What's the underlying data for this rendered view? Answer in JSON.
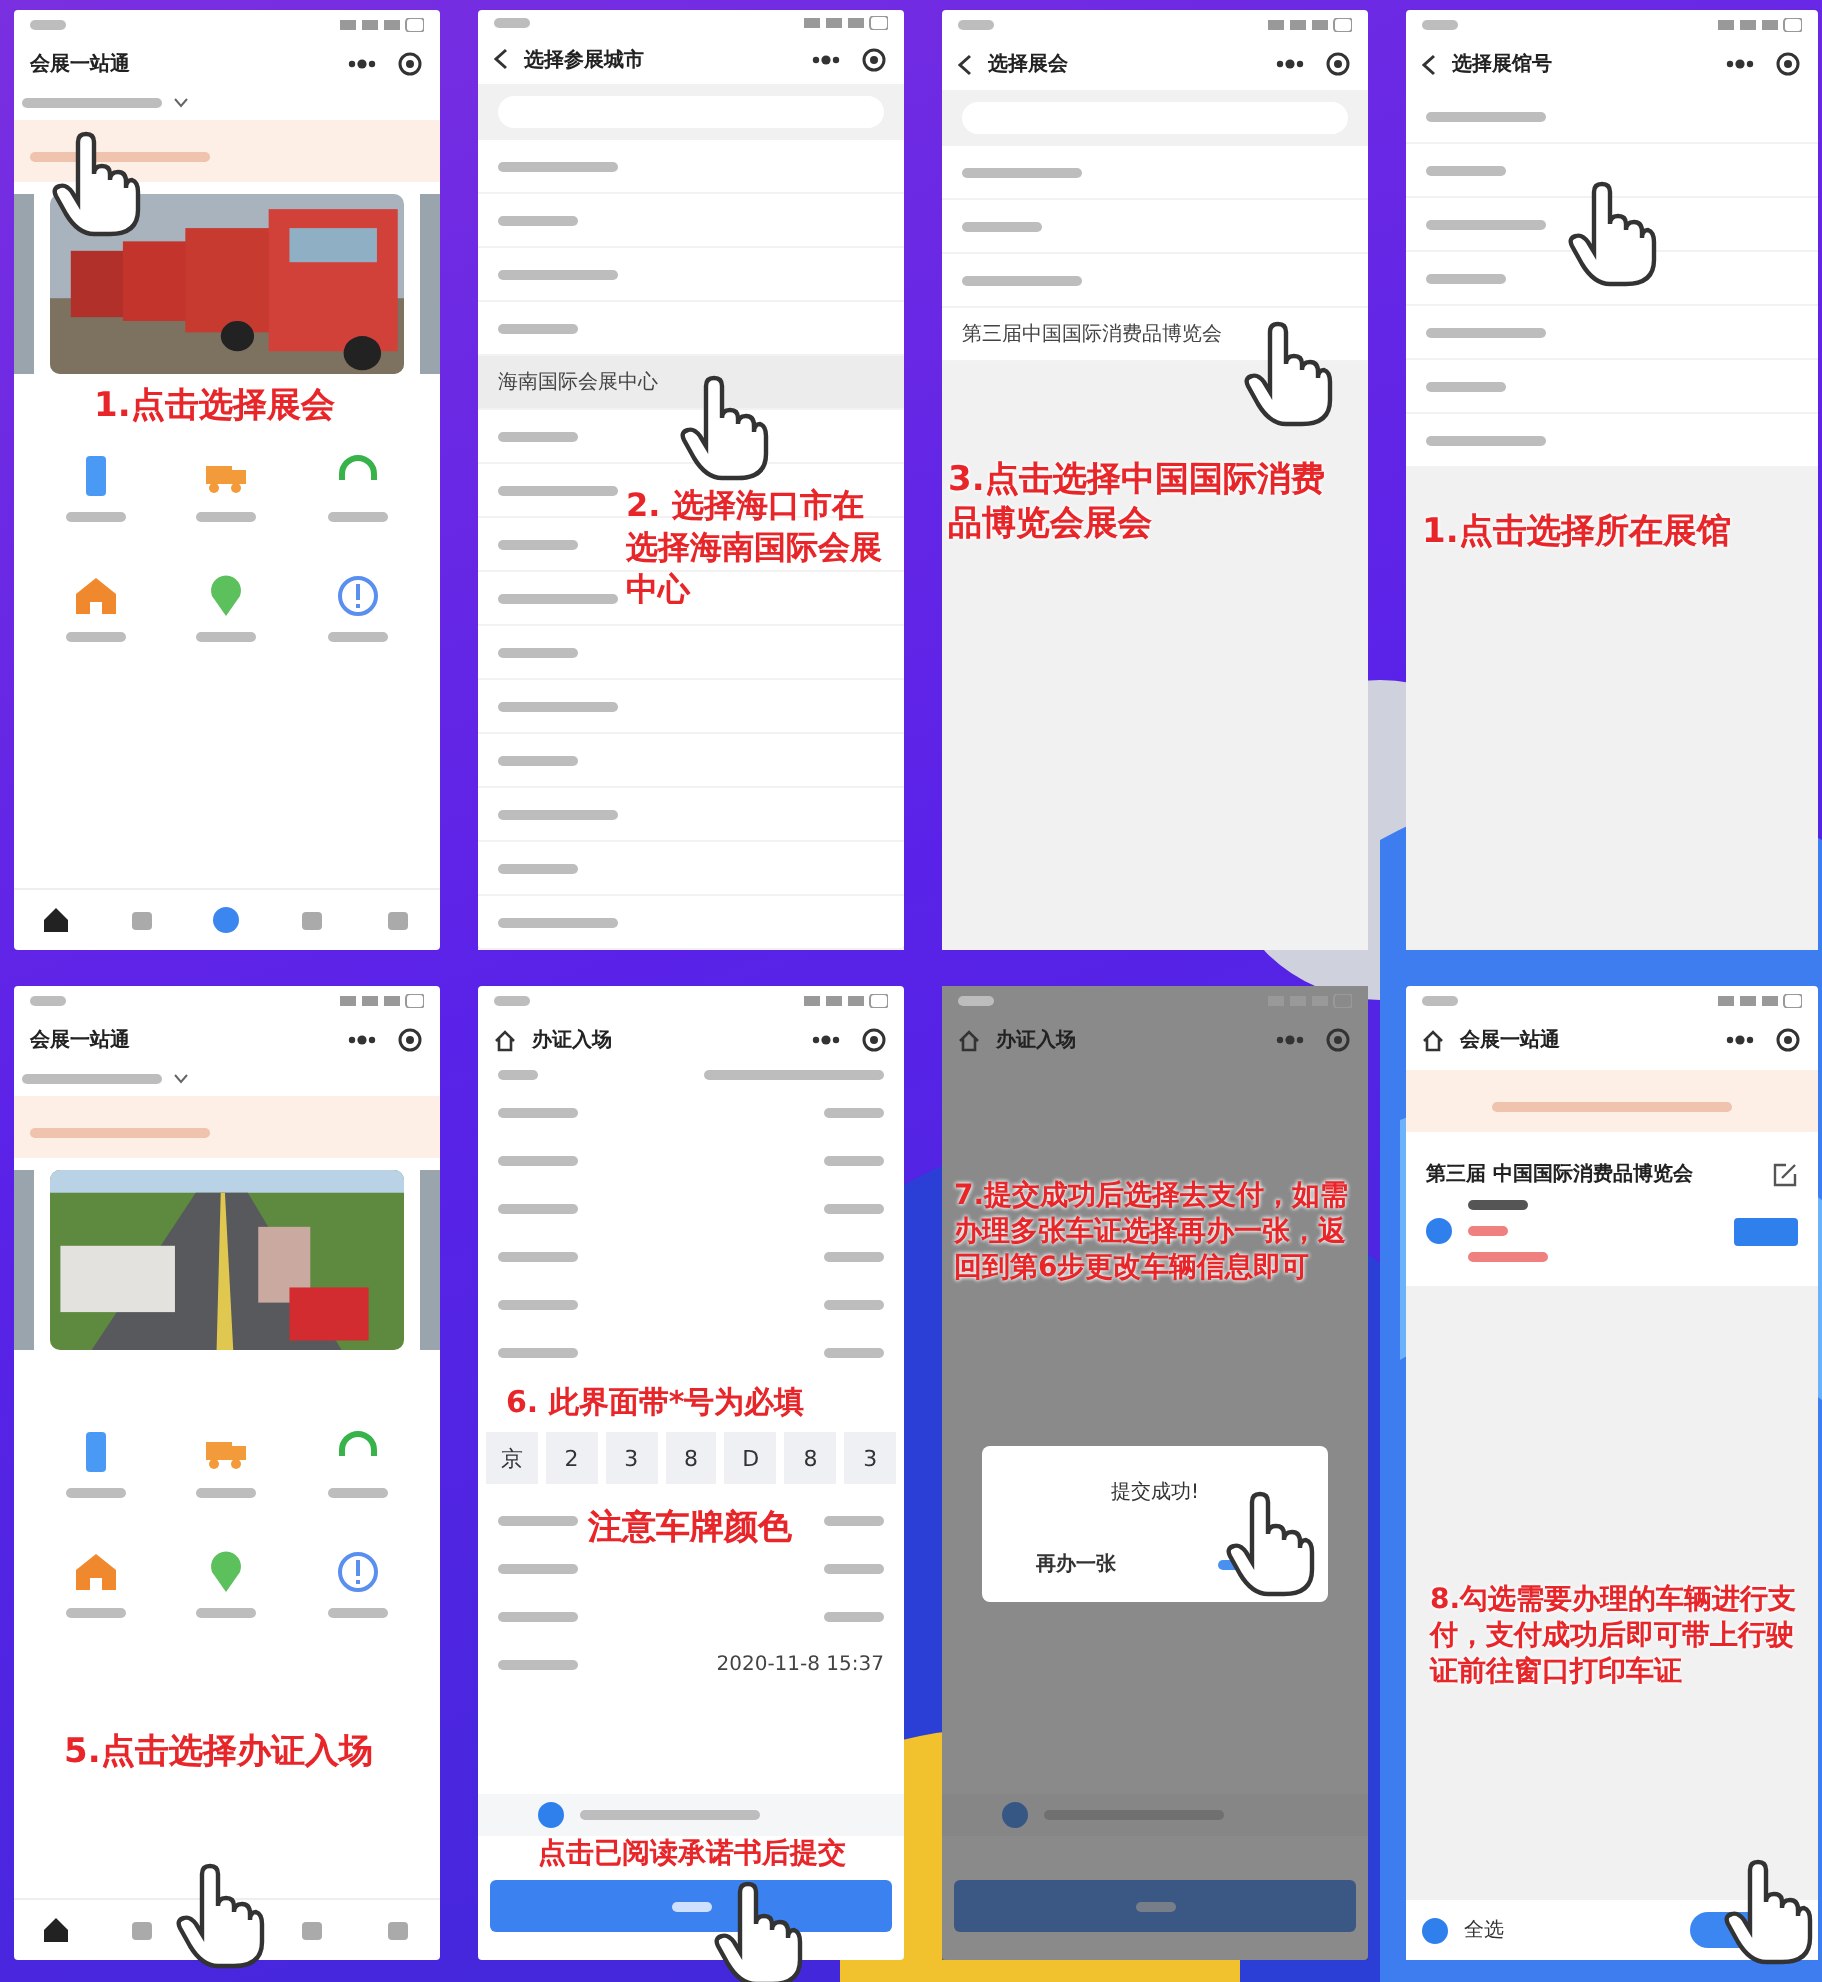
{
  "screens": [
    {
      "kind": "home",
      "title": "会展一站通",
      "annotations": [
        "1.点击选择展会"
      ]
    },
    {
      "kind": "list",
      "title": "选择参展城市",
      "search": true,
      "rows": [
        {
          "selected": false
        },
        {
          "selected": false
        },
        {
          "selected": false
        },
        {
          "selected": false
        },
        {
          "label": "海南国际会展中心",
          "selected": true
        },
        {
          "selected": false
        },
        {
          "selected": false
        },
        {
          "selected": false
        },
        {
          "selected": false
        },
        {
          "selected": false
        },
        {
          "selected": false
        },
        {
          "selected": false
        },
        {
          "selected": false
        },
        {
          "selected": false
        },
        {
          "selected": false
        }
      ],
      "annotations": [
        "2. 选择海口市在选择海南国际会展中心"
      ]
    },
    {
      "kind": "list",
      "title": "选择展会",
      "search": true,
      "rows": [
        {
          "selected": false
        },
        {
          "selected": false
        },
        {
          "selected": false
        },
        {
          "label": "第三届中国国际消费品博览会",
          "selected": false
        }
      ],
      "annotations": [
        "3.点击选择中国国际消费品博览会展会"
      ]
    },
    {
      "kind": "list",
      "title": "选择展馆号",
      "rows": [
        {
          "selected": false
        },
        {
          "selected": false
        },
        {
          "selected": false
        },
        {
          "selected": false
        },
        {
          "selected": false
        },
        {
          "selected": false
        },
        {
          "selected": false
        }
      ],
      "annotations": [
        "1.点击选择所在展馆"
      ]
    },
    {
      "kind": "home",
      "title": "会展一站通",
      "annotations": [
        "5.点击选择办证入场"
      ]
    },
    {
      "kind": "form",
      "title": "办证入场",
      "plate": [
        "京",
        "2",
        "3",
        "8",
        "D",
        "8",
        "3"
      ],
      "date": "2020-11-8 15:37",
      "agree_checked": true,
      "dimmed": false,
      "annotations": [
        "6. 此界面带*号为必填",
        "注意车牌颜色",
        "点击已阅读承诺书后提交"
      ]
    },
    {
      "kind": "form",
      "title": "办证入场",
      "agree_checked": true,
      "dimmed": true,
      "dialog": {
        "title": "提交成功!",
        "cancel": "再办一张"
      },
      "annotations": [
        "7.提交成功后选择去支付，如需办理多张车证选择再办一张，返回到第6步更改车辆信息即可"
      ]
    },
    {
      "kind": "order",
      "title": "会展一站通",
      "card": {
        "title": "第三届 中国国际消费品博览会",
        "checked": true
      },
      "select_all": {
        "label": "全选",
        "checked": true
      },
      "annotations": [
        "8.勾选需要办理的车辆进行支付，支付成功后即可带上行驶证前往窗口打印车证"
      ]
    }
  ]
}
